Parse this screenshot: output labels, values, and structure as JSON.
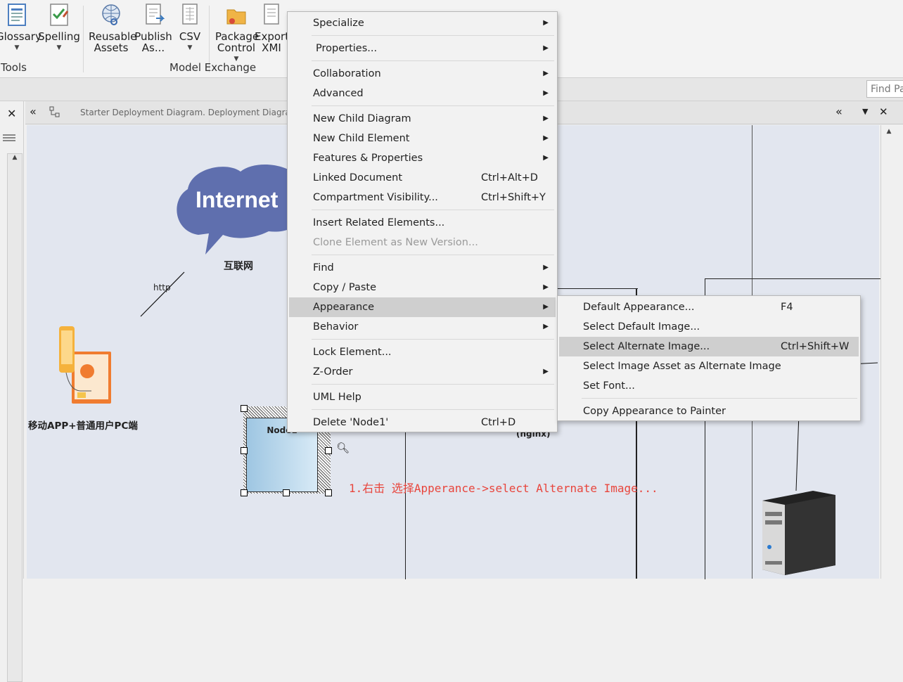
{
  "ribbon": {
    "buttons": [
      {
        "label": "Glossary",
        "icon": "glossary-icon",
        "dropdown": true
      },
      {
        "label": "Spelling",
        "icon": "spelling-icon",
        "dropdown": true
      },
      {
        "label": "Reusable Assets",
        "icon": "reusable-assets-icon",
        "dropdown": false
      },
      {
        "label": "Publish As...",
        "icon": "publish-icon",
        "dropdown": false
      },
      {
        "label": "CSV",
        "icon": "csv-icon",
        "dropdown": true
      },
      {
        "label": "Package Control",
        "icon": "package-control-icon",
        "dropdown": true
      },
      {
        "label": "Export XMI",
        "icon": "export-xmi-icon",
        "dropdown": true
      }
    ],
    "groups": {
      "tools": "Tools",
      "model_exchange": "Model Exchange"
    }
  },
  "find_placeholder": "Find Pa",
  "diagram": {
    "tab_title": "Starter Deployment Diagram.  Deployment Diagram",
    "elements": {
      "internet_cloud": "Internet",
      "internet_caption": "互联网",
      "http_label": "http",
      "mobile_caption": "移动APP+普通用户PC端",
      "node_name": "Node1",
      "nginx_label": "(nginx)",
      "annotation": "1.右击 选择Apperance->select Alternate Image..."
    }
  },
  "context_menu": {
    "items": [
      {
        "label": "Specialize",
        "submenu": true
      },
      {
        "label": "Properties...",
        "submenu": true
      },
      {
        "label": "Collaboration",
        "submenu": true
      },
      {
        "label": "Advanced",
        "submenu": true
      },
      {
        "label": "New Child Diagram",
        "submenu": true
      },
      {
        "label": "New Child Element",
        "submenu": true
      },
      {
        "label": "Features & Properties",
        "submenu": true
      },
      {
        "label": "Linked Document",
        "shortcut": "Ctrl+Alt+D"
      },
      {
        "label": "Compartment Visibility...",
        "shortcut": "Ctrl+Shift+Y"
      },
      {
        "label": "Insert Related Elements..."
      },
      {
        "label": "Clone Element as New Version...",
        "disabled": true
      },
      {
        "label": "Find",
        "submenu": true
      },
      {
        "label": "Copy / Paste",
        "submenu": true
      },
      {
        "label": "Appearance",
        "submenu": true,
        "highlighted": true
      },
      {
        "label": "Behavior",
        "submenu": true
      },
      {
        "label": "Lock Element..."
      },
      {
        "label": "Z-Order",
        "submenu": true
      },
      {
        "label": "UML Help"
      },
      {
        "label": "Delete 'Node1'",
        "shortcut": "Ctrl+D"
      }
    ]
  },
  "appearance_submenu": {
    "items": [
      {
        "label": "Default Appearance...",
        "shortcut": "F4"
      },
      {
        "label": "Select Default Image..."
      },
      {
        "label": "Select Alternate Image...",
        "shortcut": "Ctrl+Shift+W",
        "highlighted": true
      },
      {
        "label": "Select Image Asset as Alternate Image"
      },
      {
        "label": "Set Font..."
      },
      {
        "label": "Copy Appearance to Painter"
      }
    ]
  },
  "colors": {
    "annotation": "#e8453c",
    "cloud": "#5f6fae",
    "canvas": "#e2e6ef",
    "menu_highlight": "#cfcfcf"
  }
}
